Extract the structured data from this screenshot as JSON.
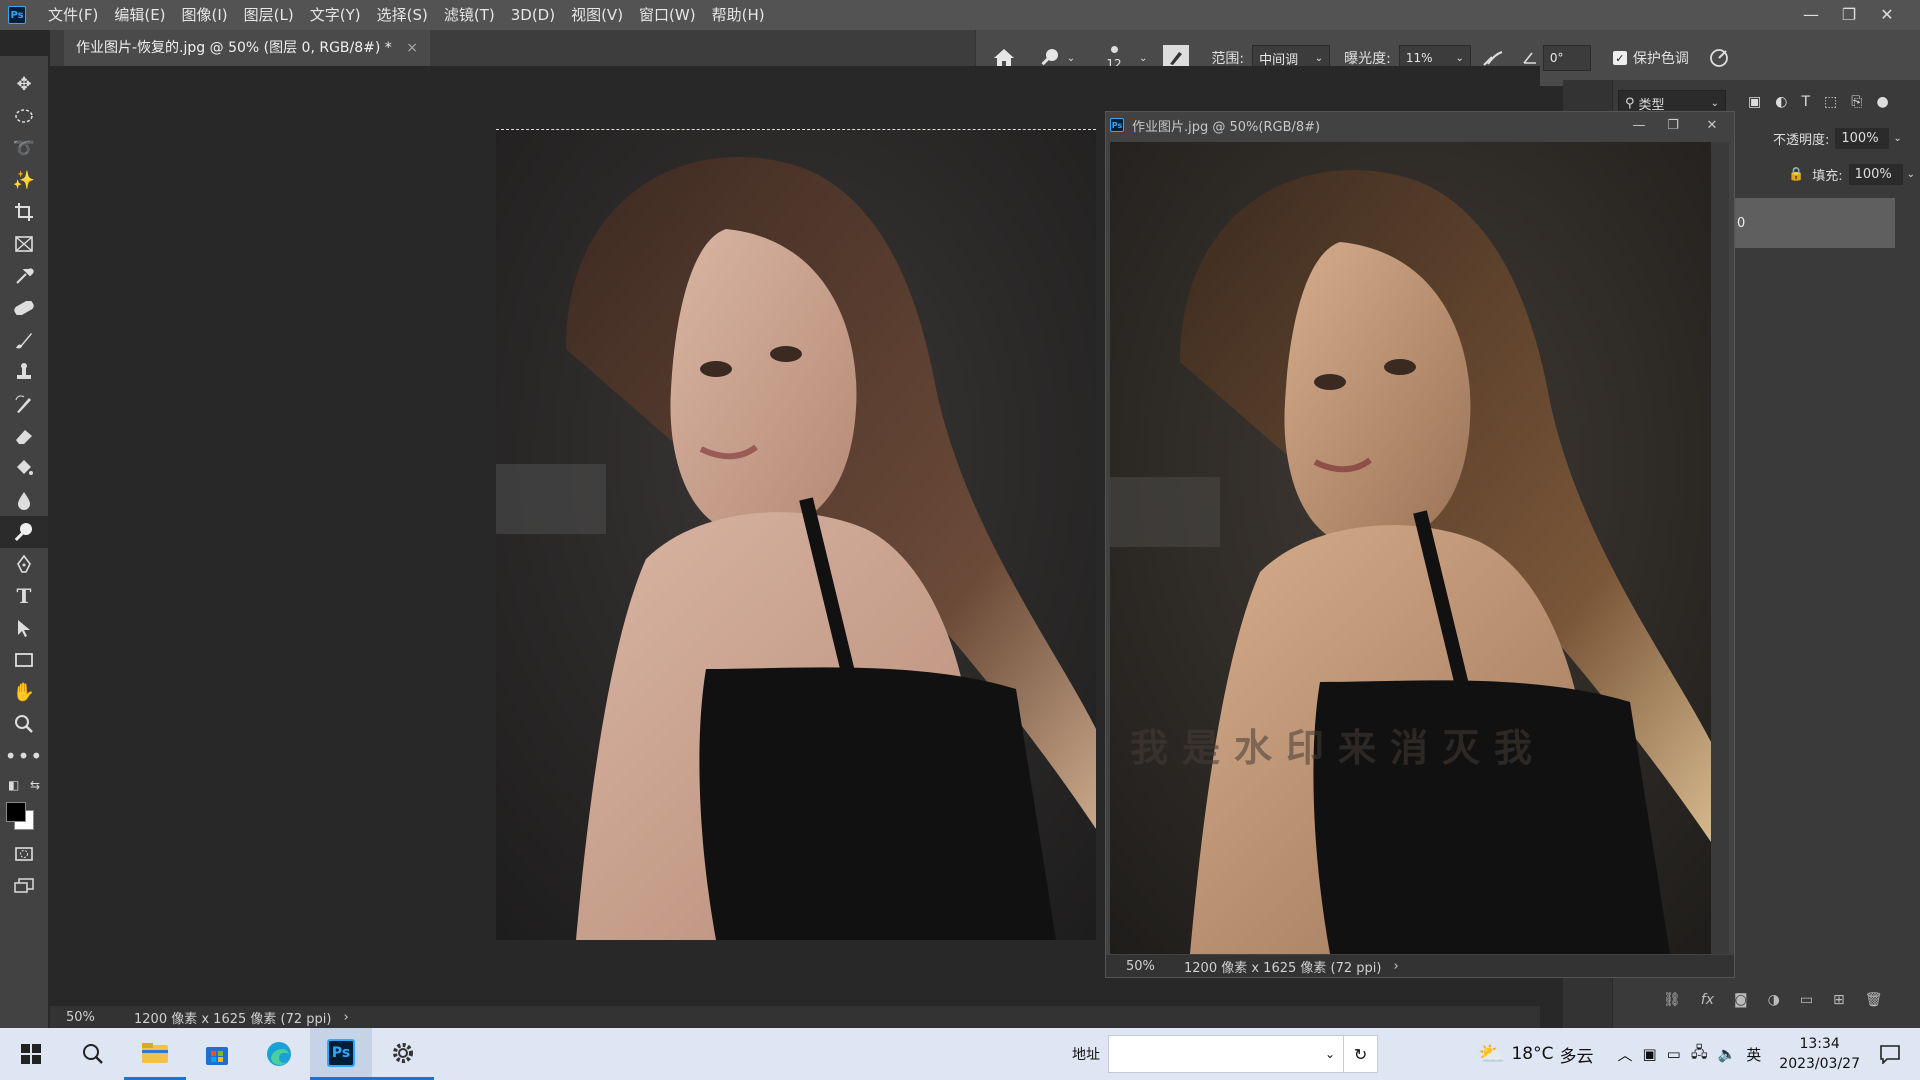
{
  "app": {
    "logo": "Ps"
  },
  "menus": [
    "文件(F)",
    "编辑(E)",
    "图像(I)",
    "图层(L)",
    "文字(Y)",
    "选择(S)",
    "滤镜(T)",
    "3D(D)",
    "视图(V)",
    "窗口(W)",
    "帮助(H)"
  ],
  "window_controls": {
    "minimize": "—",
    "restore": "❐",
    "close": "✕"
  },
  "options_bar": {
    "brush_size": "12",
    "range_label": "范围:",
    "range_value": "中间调",
    "exposure_label": "曝光度:",
    "exposure_value": "11%",
    "angle_value": "0°",
    "protect_tones_label": "保护色调",
    "protect_tones_checked": true
  },
  "document_tab": {
    "title": "作业图片-恢复的.jpg @ 50% (图层 0, RGB/8#) *",
    "close": "×"
  },
  "status_bar": {
    "zoom": "50%",
    "doc_info": "1200 像素 x 1625 像素 (72 ppi)",
    "arrow": "›"
  },
  "floating_window": {
    "title": "作业图片.jpg @ 50%(RGB/8#)",
    "watermark": "我是水印来消灭我",
    "status_zoom": "50%",
    "status_info": "1200 像素 x 1625 像素 (72 ppi)",
    "status_arrow": "›"
  },
  "layers_panel": {
    "filter_label": "类型",
    "opacity_label": "不透明度:",
    "opacity_value": "100%",
    "fill_label": "填充:",
    "fill_value": "100%",
    "layer_name_fragment": "0"
  },
  "taskbar": {
    "address_label": "地址",
    "address_value": "",
    "weather_temp": "18°C",
    "weather_desc": "多云",
    "ime": "英",
    "time": "13:34",
    "date": "2023/03/27"
  },
  "colors": {
    "menubar": "#535353",
    "panel": "#424242",
    "canvas": "#282828",
    "accent": "#31a8ff",
    "taskbar": "#dde6f2"
  }
}
